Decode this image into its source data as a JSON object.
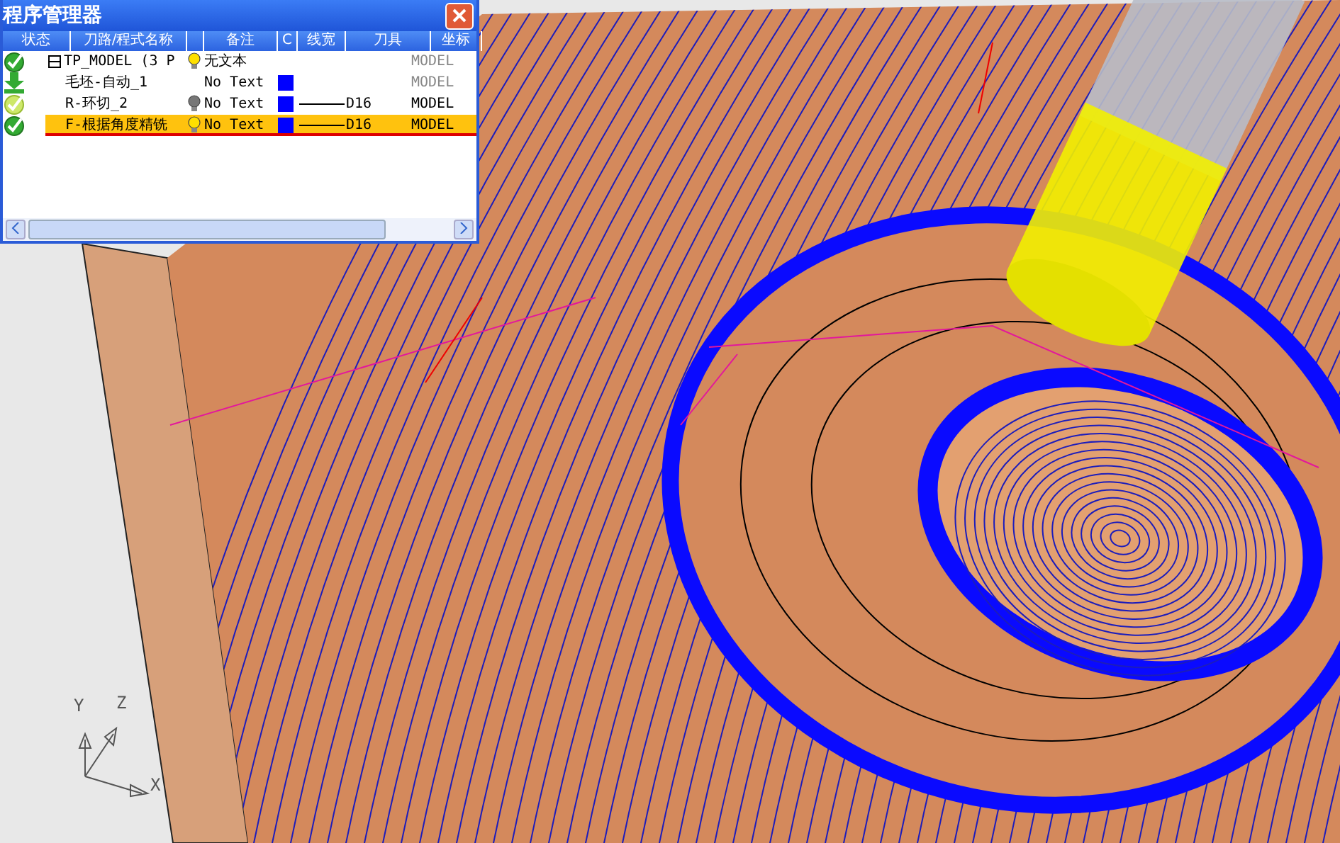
{
  "viewport": {
    "axes": {
      "x": "X",
      "y": "Y",
      "z": "Z"
    }
  },
  "panel": {
    "title": "程序管理器",
    "columns": [
      "状态",
      "刀路/程式名称",
      "",
      "备注",
      "C",
      "线宽",
      "刀具",
      "坐标"
    ],
    "rows": [
      {
        "kind": "check",
        "expanded": true,
        "name": "TP_MODEL (3 P",
        "bulb_on": true,
        "note": "无文本",
        "line": false,
        "coord": "MODEL",
        "dimmed": true,
        "selected": false
      },
      {
        "kind": "stock",
        "name": "毛坯-自动_1",
        "note": "No Text",
        "color": "#0000ff",
        "line": false,
        "coord": "MODEL",
        "dimmed": true,
        "selected": false
      },
      {
        "kind": "check-ring",
        "name": "R-环切_2",
        "bulb_on": false,
        "note": "No Text",
        "color": "#0000ff",
        "line": true,
        "tool": "D16",
        "coord": "MODEL",
        "dimmed": false,
        "selected": false
      },
      {
        "kind": "check",
        "name": "F-根据角度精铣",
        "bulb_on": true,
        "note": "No Text",
        "color": "#0000ff",
        "line": true,
        "tool": "D16",
        "coord": "MODEL",
        "dimmed": false,
        "selected": true
      }
    ]
  }
}
